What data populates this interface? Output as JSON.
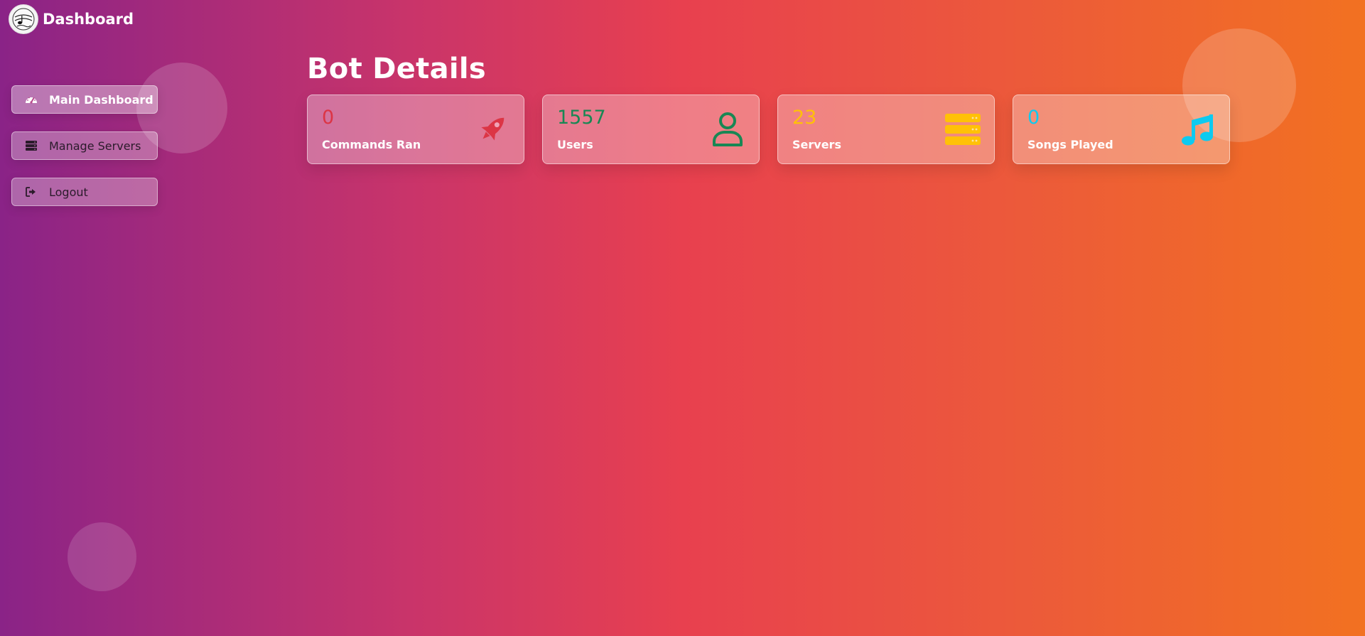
{
  "header": {
    "title": "Dashboard",
    "logo_icon": "music-logo-icon"
  },
  "sidebar": {
    "items": [
      {
        "label": "Main Dashboard",
        "icon": "tachometer-icon",
        "active": true
      },
      {
        "label": "Manage Servers",
        "icon": "server-icon",
        "active": false
      },
      {
        "label": "Logout",
        "icon": "sign-out-icon",
        "active": false
      }
    ]
  },
  "main": {
    "title": "Bot Details",
    "cards": [
      {
        "value": "0",
        "label": "Commands Ran",
        "icon": "rocket-icon",
        "color": "#dc3545"
      },
      {
        "value": "1557",
        "label": "Users",
        "icon": "user-icon",
        "color": "#198754"
      },
      {
        "value": "23",
        "label": "Servers",
        "icon": "server-stack-icon",
        "color": "#ffc107"
      },
      {
        "value": "0",
        "label": "Songs Played",
        "icon": "music-note-icon",
        "color": "#0dcaf0"
      }
    ]
  },
  "colors": {
    "gradient_start": "#8a2387",
    "gradient_mid": "#e94057",
    "gradient_end": "#f27121"
  }
}
